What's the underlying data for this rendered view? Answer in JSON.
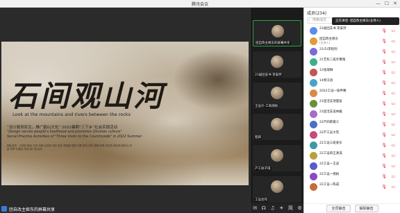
{
  "window": {
    "title": "腾讯会议",
    "min": "—",
    "max": "☐",
    "close": "✕"
  },
  "share": {
    "big_title": "石间观山河",
    "en_subtitle": "Look at the mountains and rivers between the rocks",
    "cn_line": "“设计服务民生，推广鹤山文化” 2022暑期“三下乡”社会实践活动",
    "en_line1": "\"Design serves people's livelihood and promotes Qinshan culture\"",
    "en_line2": "Social Practice Activities of \"Three Visits to the Countryside\" in 2022 Summer",
    "credits": "团队成员：王成拓 程目 王任 刘嫣 吕尽林 刘欣 张迅 李晓琳 邹陈 刘秀 罗志 何竹 周明 陈聪 宋宏亮 杨红瑞 韩苏兵 刘颖 李梦 叶雅洁 刘伟 高少如 赵玲",
    "sharer_label": "团自改主姬东的屏幕共享"
  },
  "videos": [
    {
      "name": "团自改主姬东的屏幕共享",
      "active": true
    },
    {
      "name": "21级团支书 李安然",
      "active": false
    },
    {
      "name": "王设计-工商测绘",
      "active": false
    },
    {
      "name": "程目",
      "active": false
    },
    {
      "name": "产工徐子琪",
      "active": false
    },
    {
      "name": "工设合作",
      "active": false
    }
  ],
  "toolbar": {
    "icons": [
      "✉",
      "☊",
      "♫",
      "☀",
      "简",
      "⚙"
    ]
  },
  "members": {
    "header": "成员(234)",
    "search_placeholder": "搜索成员",
    "speaking": "正在讲话: 团自改主姬东(主持人)",
    "list": [
      {
        "name": "21级团支书 李安然",
        "role": "",
        "color": "#5b8def"
      },
      {
        "name": "团自改主姬东",
        "role": "(主持人)",
        "color": "#e59a3a"
      },
      {
        "name": "21(5)李程钊",
        "role": "",
        "color": "#7b6bd8"
      },
      {
        "name": "21艺科二班许曹嗡",
        "role": "",
        "color": "#3ab08c"
      },
      {
        "name": "12张瑞琳",
        "role": "",
        "color": "#c25555"
      },
      {
        "name": "14郭汉语",
        "role": "",
        "color": "#4aa3c8"
      },
      {
        "name": "2022工设一级申赛",
        "role": "",
        "color": "#d88a4a"
      },
      {
        "name": "21团活支测量盈",
        "role": "",
        "color": "#6c8f3a"
      },
      {
        "name": "21团活支美林媛",
        "role": "",
        "color": "#a66bc8"
      },
      {
        "name": "22产四蔡嘉义",
        "role": "",
        "color": "#4a6fc8"
      },
      {
        "name": "22产工吴大凯",
        "role": "",
        "color": "#c84a7a"
      },
      {
        "name": "22工设三班姜东",
        "role": "",
        "color": "#3a9aa6"
      },
      {
        "name": "22工设四王源淇",
        "role": "",
        "color": "#b8a03a"
      },
      {
        "name": "22工设一王迪",
        "role": "",
        "color": "#5a5ac8"
      },
      {
        "name": "22工设一杨帆",
        "role": "",
        "color": "#8a4ac8"
      },
      {
        "name": "22工设一陈成",
        "role": "",
        "color": "#c86a3a"
      }
    ],
    "mute_all": "全员静音",
    "unmute_all": "解除静音"
  }
}
